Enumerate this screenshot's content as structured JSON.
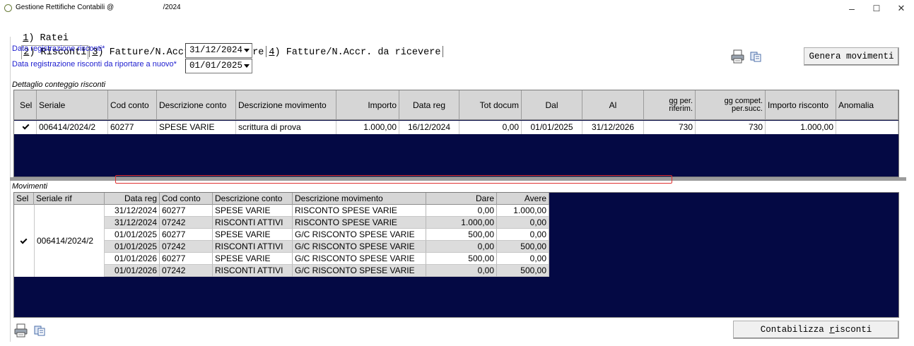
{
  "window": {
    "title": "Gestione Rettifiche Contabili @",
    "title_suffix": "/2024",
    "minimize": "–",
    "maximize": "☐",
    "close": "✕"
  },
  "tabs": [
    {
      "key": "1",
      "label": ") Ratei"
    },
    {
      "key": "2",
      "label": ") Risconti"
    },
    {
      "key": "3",
      "label": ") Fatture/N.Accr. da emettere"
    },
    {
      "key": "4",
      "label": ") Fatture/N.Accr. da ricevere"
    }
  ],
  "form": {
    "reg_label": "Data registrazione risconti*",
    "reg_value": "31/12/2024",
    "new_label": "Data registrazione risconti da riportare a nuovo*",
    "new_value": "01/01/2025"
  },
  "buttons": {
    "genera": "Genera movimenti",
    "contabilizza_pre": "Contabilizza ",
    "contabilizza_u": "r",
    "contabilizza_post": "isconti"
  },
  "detail": {
    "section_label": "Dettaglio conteggio risconti",
    "headers": {
      "sel": "Sel",
      "seriale": "Seriale",
      "cod_conto": "Cod conto",
      "desc_conto": "Descrizione conto",
      "desc_mov": "Descrizione movimento",
      "importo": "Importo",
      "data_reg": "Data reg",
      "tot_docum": "Tot docum",
      "dal": "Dal",
      "al": "Al",
      "gg_rif_1": "gg per.",
      "gg_rif_2": "riferim.",
      "gg_comp_1": "gg compet.",
      "gg_comp_2": "per.succ.",
      "importo_risconto": "Importo risconto",
      "anomalia": "Anomalia"
    },
    "row": {
      "selected": true,
      "seriale": "006414/2024/2",
      "cod_conto": "60277",
      "desc_conto": "SPESE VARIE",
      "desc_mov": "scrittura di prova",
      "importo": "1.000,00",
      "data_reg": "16/12/2024",
      "tot_docum": "0,00",
      "dal": "01/01/2025",
      "al": "31/12/2026",
      "gg_rif": "730",
      "gg_comp": "730",
      "importo_risconto": "1.000,00",
      "anomalia": ""
    }
  },
  "movements": {
    "section_label": "Movimenti",
    "headers": {
      "sel": "Sel",
      "seriale_rif": "Seriale rif",
      "data_reg": "Data reg",
      "cod_conto": "Cod conto",
      "desc_conto": "Descrizione conto",
      "desc_mov": "Descrizione movimento",
      "dare": "Dare",
      "avere": "Avere"
    },
    "group": {
      "selected": true,
      "seriale_rif": "006414/2024/2"
    },
    "rows": [
      {
        "data_reg": "31/12/2024",
        "cod_conto": "60277",
        "desc_conto": "SPESE VARIE",
        "desc_mov": "RISCONTO SPESE VARIE",
        "dare": "0,00",
        "avere": "1.000,00"
      },
      {
        "data_reg": "31/12/2024",
        "cod_conto": "07242",
        "desc_conto": "RISCONTI ATTIVI",
        "desc_mov": "RISCONTO SPESE VARIE",
        "dare": "1.000,00",
        "avere": "0,00"
      },
      {
        "data_reg": "01/01/2025",
        "cod_conto": "60277",
        "desc_conto": "SPESE VARIE",
        "desc_mov": "G/C RISCONTO SPESE VARIE",
        "dare": "500,00",
        "avere": "0,00"
      },
      {
        "data_reg": "01/01/2025",
        "cod_conto": "07242",
        "desc_conto": "RISCONTI ATTIVI",
        "desc_mov": "G/C RISCONTO SPESE VARIE",
        "dare": "0,00",
        "avere": "500,00"
      },
      {
        "data_reg": "01/01/2026",
        "cod_conto": "60277",
        "desc_conto": "SPESE VARIE",
        "desc_mov": "G/C RISCONTO SPESE VARIE",
        "dare": "500,00",
        "avere": "0,00"
      },
      {
        "data_reg": "01/01/2026",
        "cod_conto": "07242",
        "desc_conto": "RISCONTI ATTIVI",
        "desc_mov": "G/C RISCONTO SPESE VARIE",
        "dare": "0,00",
        "avere": "500,00"
      }
    ]
  },
  "colors": {
    "grid_background": "#040944",
    "label_blue": "#1c1ccf",
    "highlight_red": "#e03030"
  }
}
